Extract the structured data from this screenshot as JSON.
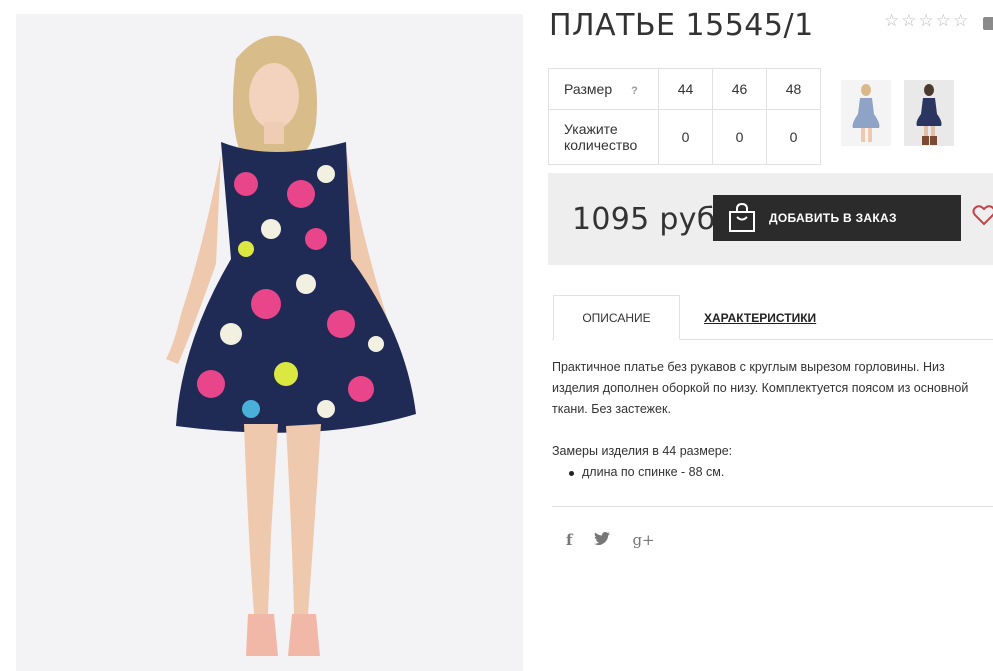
{
  "product": {
    "title": "ПЛАТЬЕ 15545/1",
    "rating_stars": [
      "☆",
      "☆",
      "☆",
      "☆",
      "☆"
    ],
    "price": "1095 руб",
    "add_to_order_label": "ДОБАВИТЬ В ЗАКАЗ"
  },
  "size_table": {
    "size_label": "Размер",
    "help_mark": "?",
    "sizes": [
      "44",
      "46",
      "48"
    ],
    "qty_label": "Укажите количество",
    "qty_values": [
      "0",
      "0",
      "0"
    ]
  },
  "tabs": {
    "description": "ОПИСАНИЕ",
    "specs": "ХАРАКТЕРИСТИКИ"
  },
  "description": {
    "lines": [
      "Практичное платье без рукавов с круглым вырезом горловины. Низ",
      "изделия дополнен оборкой по низу. Комплектуется поясом из основной",
      "ткани. Без застежек."
    ],
    "measures_title": "Замеры изделия в 44 размере:",
    "measures": [
      "длина по спинке - 88 см."
    ]
  },
  "social": {
    "facebook": "f",
    "twitter": "🐦",
    "google_plus": "g+"
  },
  "icons": {
    "bag": "shopping-bag-icon",
    "heart": "heart-icon",
    "comment": "comment-icon"
  },
  "colors": {
    "button_bg": "#2b2b2b",
    "price_bg": "#eeeeee",
    "dress_navy": "#1f2a55",
    "accent_heart": "#c0444a"
  }
}
